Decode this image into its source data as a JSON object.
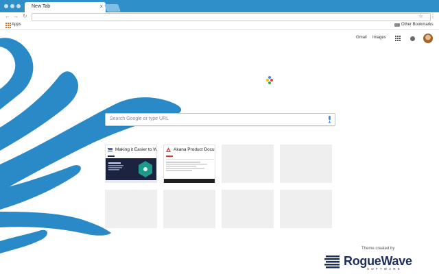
{
  "browser": {
    "tab_title": "New Tab",
    "tab_close": "×",
    "nav_back": "←",
    "nav_forward": "→",
    "nav_reload": "↻",
    "omnibox_value": "",
    "star_icon": "☆",
    "menu_icon": "⋮"
  },
  "bookmarks_bar": {
    "apps_label": "Apps",
    "other_bookmarks_label": "Other Bookmarks"
  },
  "header_links": {
    "gmail": "Gmail",
    "images": "Images"
  },
  "search": {
    "placeholder": "Search Google or type URL"
  },
  "most_visited": [
    {
      "title": "Making it Easier to W",
      "icon": "roguewave-favicon"
    },
    {
      "title": "Akana Product Docu",
      "icon": "akana-favicon"
    }
  ],
  "theme_credit": {
    "label": "Theme created by",
    "brand_name": "RogueWave",
    "brand_sub": "SOFTWARE"
  },
  "colors": {
    "frame": "#2f8fc9",
    "accent_stripe": "#2a8ac7",
    "tile_placeholder": "#efefef",
    "brand_navy": "#1c2f5c"
  }
}
